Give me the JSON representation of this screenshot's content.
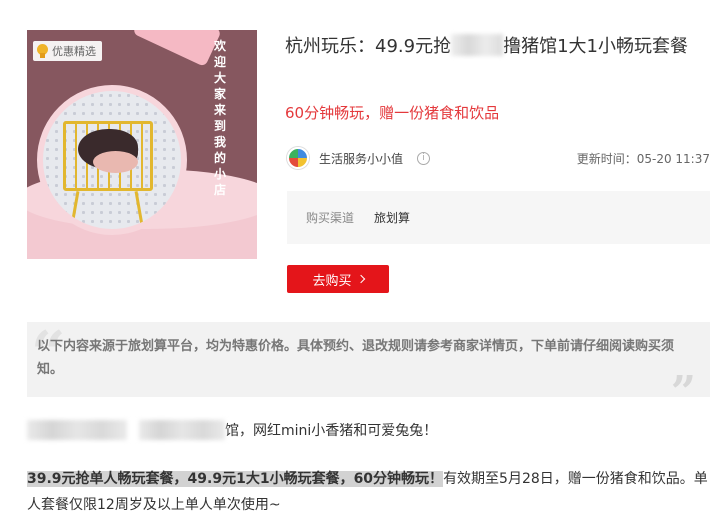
{
  "product": {
    "badge_label": "优惠精选",
    "image_caption": "欢迎大家来到我的小店",
    "title_before": "杭州玩乐：49.9元抢",
    "title_after": "撸猪馆1大1小畅玩套餐",
    "subtitle": "60分钟畅玩，赠一份猪食和饮品"
  },
  "merchant": {
    "name": "生活服务小小值",
    "info_glyph": "i",
    "update_time": "更新时间：05-20 11:37"
  },
  "channel": {
    "label": "购买渠道",
    "value": "旅划算"
  },
  "buy_button": {
    "label": "去购买"
  },
  "disclaimer": {
    "text": "以下内容来源于旅划算平台，均为特惠价格。具体预约、退改规则请参考商家详情页，下单前请仔细阅读购买须知。"
  },
  "content": {
    "intro_suffix": "馆，网红mini小香猪和可爱兔兔！",
    "deal_highlight": "39.9元抢单人畅玩套餐，49.9元1大1小畅玩套餐，60分钟畅玩！",
    "deal_rest": "有效期至5月28日，赠一份猪食和饮品。单人套餐仅限12周岁及以上单人单次使用~"
  },
  "colors": {
    "accent_red": "#e4151a",
    "subtitle_red": "#e4393c",
    "image_background": "#86575f",
    "cart_yellow": "#e2b72f"
  }
}
